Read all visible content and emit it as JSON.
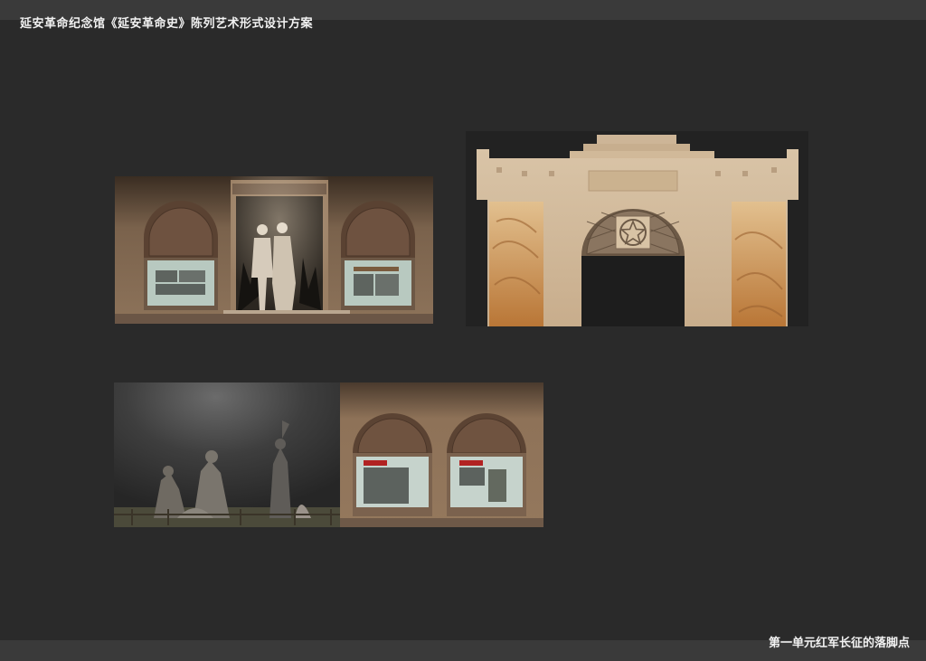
{
  "header": {
    "title": "延安革命纪念馆《延安革命史》陈列艺术形式设计方案"
  },
  "footer": {
    "caption": "第一单元红军长征的落脚点"
  },
  "renderings": [
    {
      "name": "statue-hall-rendering",
      "icons": [
        "statue-icon",
        "display-case-icon"
      ]
    },
    {
      "name": "gate-facade-rendering",
      "icons": [
        "star-emblem-icon",
        "relief-panel-icon"
      ]
    },
    {
      "name": "sculpture-and-arches-rendering",
      "icons": [
        "sculpture-group-icon",
        "display-case-icon"
      ]
    }
  ],
  "colors": {
    "background": "#2a2a2a",
    "bar": "#3a3a3a",
    "text": "#f2f2f2",
    "wall": "#8a7058",
    "gate": "#d9c3a6",
    "relief": "#c78c4a"
  }
}
